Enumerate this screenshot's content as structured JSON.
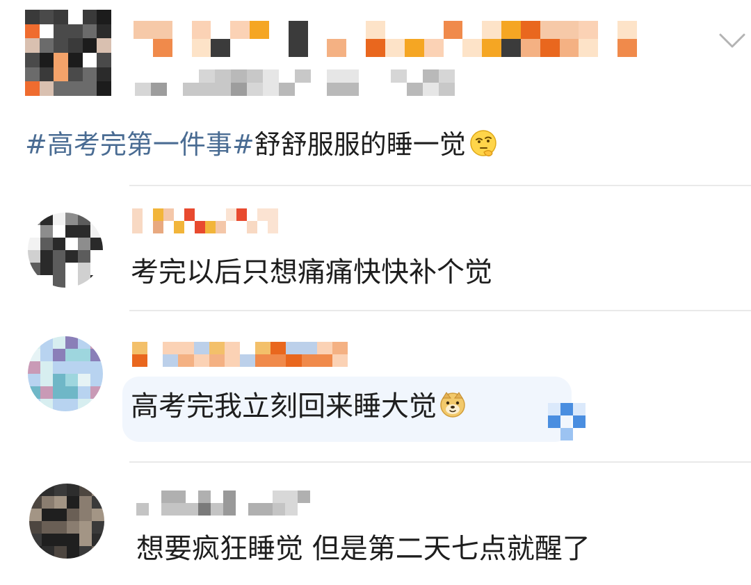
{
  "post": {
    "hashtag": "#高考完第一件事#",
    "text": "舒舒服服的睡一觉",
    "emoji": "thinking-face-icon"
  },
  "comments": [
    {
      "text": "考完以后只想痛痛快快补个觉"
    },
    {
      "text": "高考完我立刻回来睡大觉",
      "emoji": "doge-icon"
    },
    {
      "text": "想要疯狂睡觉 但是第二天七点就醒了"
    }
  ],
  "colors": {
    "hashtag": "#4a6c93",
    "text": "#1d1d1d",
    "divider": "#e9e9e9",
    "highlight": "#f1f6fd"
  }
}
